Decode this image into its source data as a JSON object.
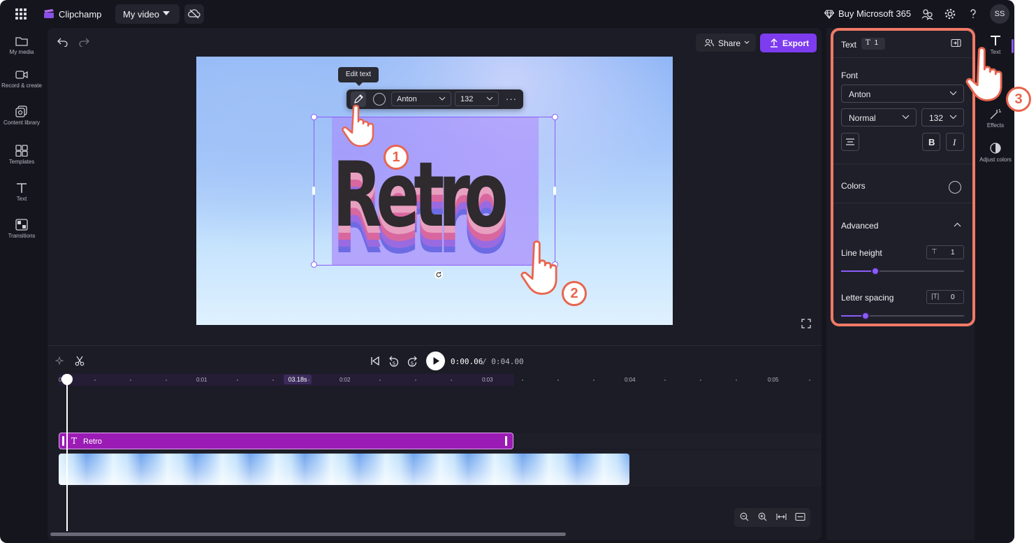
{
  "topbar": {
    "app_name": "Clipchamp",
    "project_title": "My video",
    "buy_label": "Buy Microsoft 365",
    "avatar_initials": "SS"
  },
  "leftnav": {
    "items": [
      {
        "label": "My media",
        "icon": "folder-icon"
      },
      {
        "label": "Record & create",
        "icon": "camera-icon"
      },
      {
        "label": "Content library",
        "icon": "library-icon"
      },
      {
        "label": "Templates",
        "icon": "templates-icon"
      },
      {
        "label": "Text",
        "icon": "text-icon"
      },
      {
        "label": "Transitions",
        "icon": "transitions-icon"
      }
    ]
  },
  "toolbar": {
    "share_label": "Share",
    "export_label": "Export"
  },
  "canvas": {
    "text_content": "Retro",
    "tooltip": "Edit text",
    "floating_font": "Anton",
    "floating_size": "132"
  },
  "timeline": {
    "current_time": "0:00.06",
    "total_time": "/ 0:04.00",
    "playhead_badge": "03.18s",
    "tick_labels": [
      "0",
      "0:01",
      "0:02",
      "0:03",
      "0:04",
      "0:05"
    ],
    "text_clip_label": "Retro"
  },
  "text_panel": {
    "title": "Text",
    "badge_value": "1",
    "font_section": "Font",
    "font_value": "Anton",
    "style_value": "Normal",
    "size_value": "132",
    "colors_label": "Colors",
    "advanced_label": "Advanced",
    "line_height_label": "Line height",
    "line_height_value": "1",
    "line_height_fraction": 0.28,
    "letter_spacing_label": "Letter spacing",
    "letter_spacing_value": "0",
    "letter_spacing_fraction": 0.2
  },
  "rail": {
    "items": [
      {
        "label": "Text",
        "icon": "text-icon"
      },
      {
        "label": "Effects",
        "icon": "magic-wand-icon"
      },
      {
        "label": "Adjust colors",
        "icon": "contrast-icon"
      }
    ]
  },
  "callouts": [
    "1",
    "2",
    "3"
  ],
  "colors": {
    "accent": "#7d3cf0",
    "callout": "#e8654f",
    "text_clip": "#9b1cb5"
  }
}
